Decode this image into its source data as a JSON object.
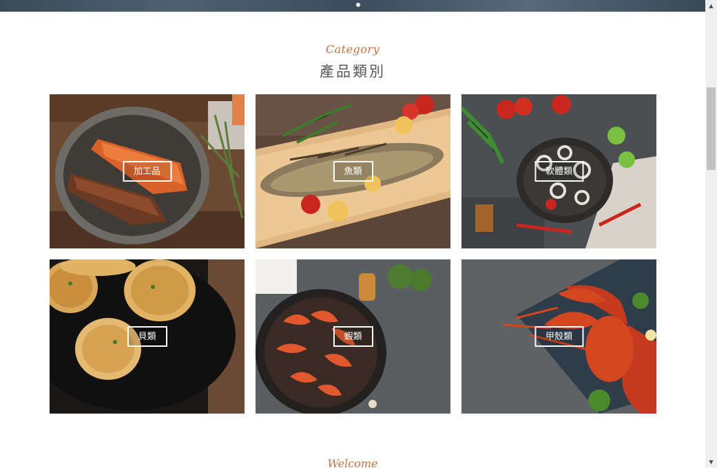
{
  "banner": {
    "slide_indicator": "•"
  },
  "category": {
    "script_title": "Category",
    "title": "產品類別",
    "items": [
      {
        "label": "加工品"
      },
      {
        "label": "魚類"
      },
      {
        "label": "軟體類"
      },
      {
        "label": "貝類"
      },
      {
        "label": "蝦類"
      },
      {
        "label": "甲殼類"
      }
    ]
  },
  "next_section": {
    "script_title": "Welcome"
  },
  "scrollbar": {
    "up_glyph": "▲",
    "down_glyph": "▼"
  },
  "colors": {
    "accent": "#c0703d",
    "title": "#555555"
  }
}
